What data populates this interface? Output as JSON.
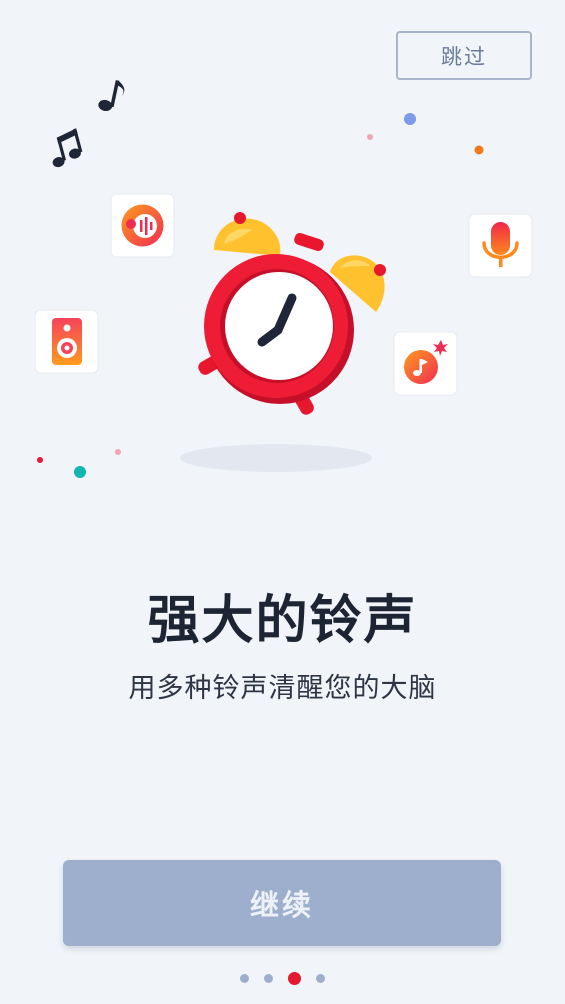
{
  "header": {
    "skip_label": "跳过"
  },
  "onboarding": {
    "title": "强大的铃声",
    "subtitle": "用多种铃声清醒您的大脑",
    "continue_label": "继续"
  },
  "pager": {
    "total": 4,
    "current_index": 2
  },
  "illustration": {
    "icons": [
      "music-note-icon",
      "music-note-icon",
      "podcast-app-icon",
      "speaker-app-icon",
      "alarm-clock-icon",
      "microphone-app-icon",
      "music-player-app-icon"
    ]
  },
  "colors": {
    "background": "#f1f4f9",
    "button": "#9dafcc",
    "accent": "#e4182e",
    "title": "#1d2433"
  }
}
